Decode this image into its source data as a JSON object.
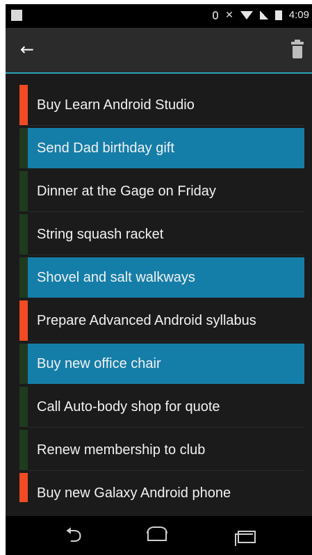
{
  "status_bar": {
    "time": "4:09",
    "icons": [
      "notification-icon",
      "bluetooth-icon",
      "mute-icon",
      "wifi-icon",
      "signal-icon",
      "battery-icon"
    ]
  },
  "app_bar": {
    "back_icon": "arrow-left-icon",
    "delete_icon": "trash-icon"
  },
  "reminders": [
    {
      "text": "Buy Learn Android Studio",
      "priority": "high",
      "selected": false
    },
    {
      "text": "Send Dad birthday gift",
      "priority": "low",
      "selected": true
    },
    {
      "text": "Dinner at the Gage on Friday",
      "priority": "low",
      "selected": false
    },
    {
      "text": "String squash racket",
      "priority": "low",
      "selected": false
    },
    {
      "text": "Shovel and salt walkways",
      "priority": "low",
      "selected": true
    },
    {
      "text": "Prepare Advanced Android syllabus",
      "priority": "high",
      "selected": false
    },
    {
      "text": "Buy new office chair",
      "priority": "low",
      "selected": true
    },
    {
      "text": "Call Auto-body shop for quote",
      "priority": "low",
      "selected": false
    },
    {
      "text": "Renew membership to club",
      "priority": "low",
      "selected": false
    },
    {
      "text": "Buy new Galaxy Android phone",
      "priority": "high",
      "selected": false
    }
  ],
  "colors": {
    "high_priority": "#f04b23",
    "low_priority": "#1f3a1f",
    "selected_row": "#157ea8",
    "accent_line": "#2aa3b8"
  },
  "nav_bar": {
    "buttons": [
      "back-nav-icon",
      "home-nav-icon",
      "recents-nav-icon"
    ]
  }
}
